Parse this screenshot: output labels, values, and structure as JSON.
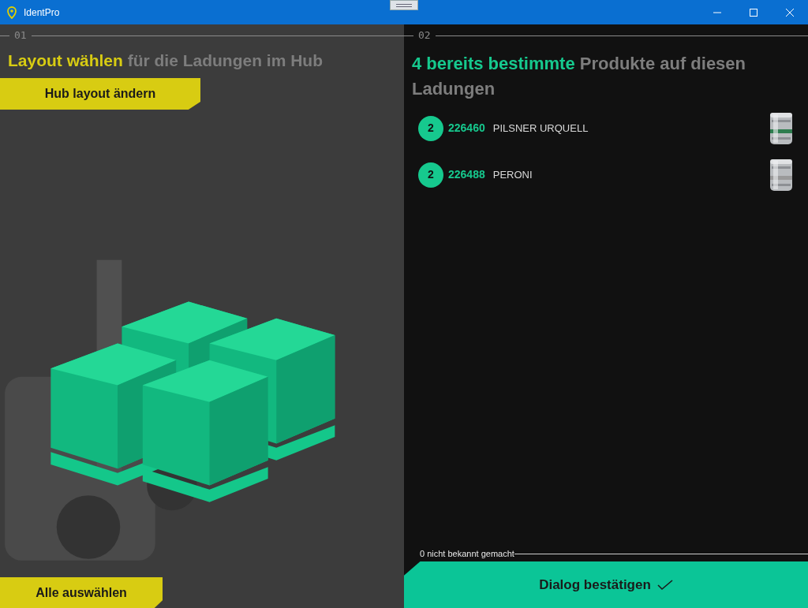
{
  "window": {
    "title": "IdentPro"
  },
  "left": {
    "step": "01",
    "title_highlight": "Layout wählen",
    "title_rest": "für die Ladungen im Hub",
    "change_button": "Hub layout ändern",
    "select_all_button": "Alle auswählen"
  },
  "right": {
    "step": "02",
    "title_highlight": "4 bereits bestimmte",
    "title_rest": "Produkte auf diesen Ladungen",
    "products": [
      {
        "count": "2",
        "code": "226460",
        "name": "PILSNER URQUELL"
      },
      {
        "count": "2",
        "code": "226488",
        "name": "PERONI"
      }
    ],
    "unknown_note": "0 nicht bekannt gemacht",
    "confirm_button": "Dialog bestätigen"
  }
}
